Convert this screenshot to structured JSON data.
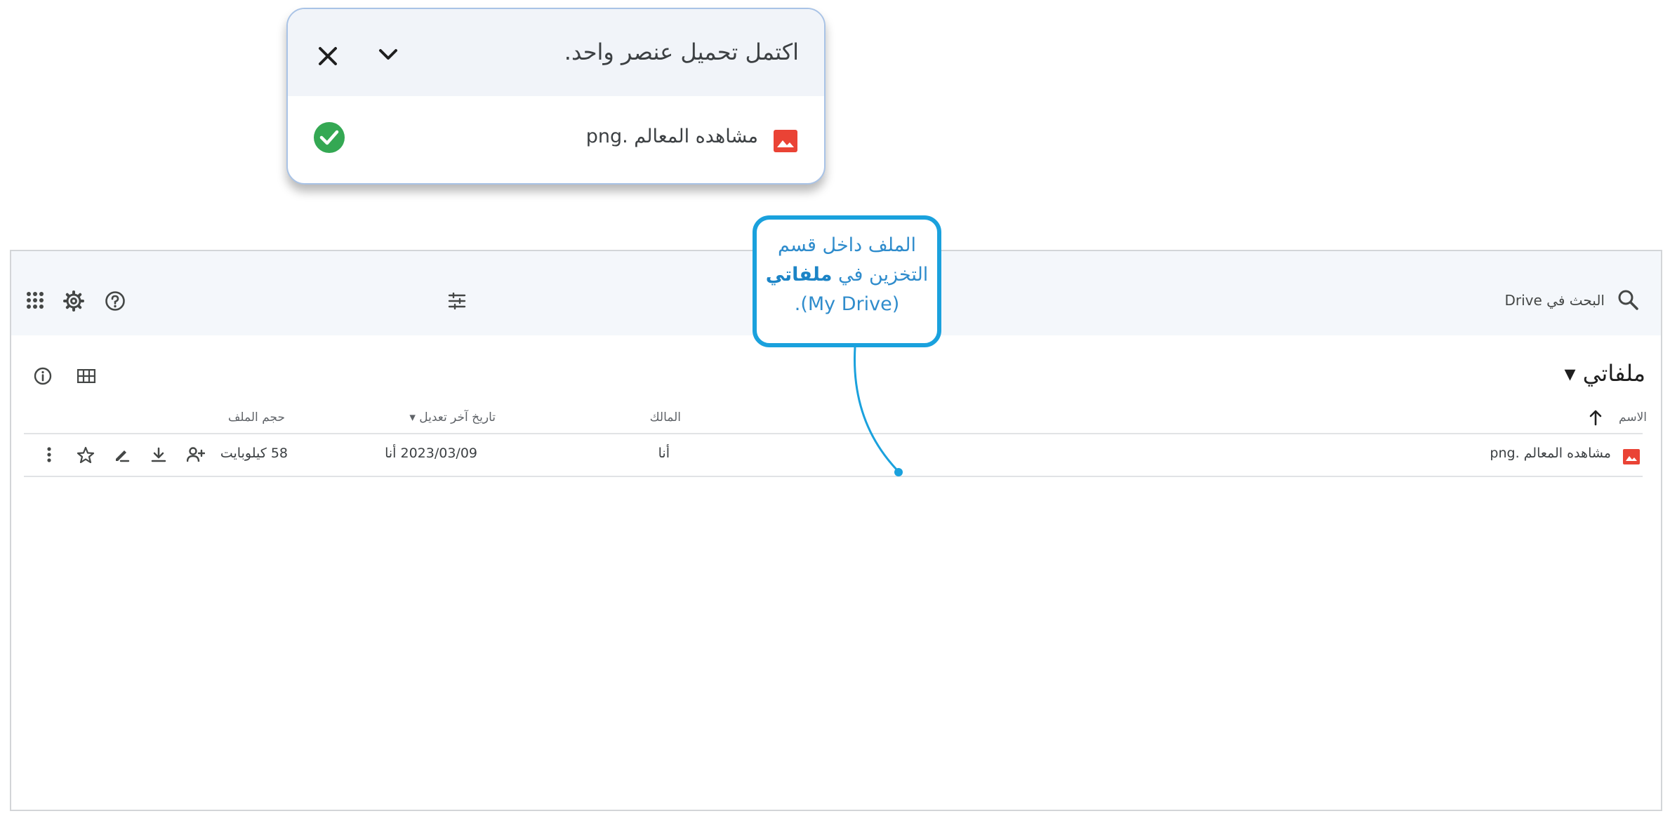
{
  "upload_toast": {
    "title": "اكتمل تحميل عنصر واحد.",
    "file_name": "مشاهده المعالم .png",
    "icons": {
      "collapse": "chevron-down-icon",
      "close": "close-icon",
      "file": "image-file-icon",
      "status": "check-circle-icon"
    },
    "status_color": "#34a853"
  },
  "drive": {
    "search_text": "البحث في Drive",
    "folder_title": "ملفاتي ▾",
    "columns": {
      "name": "الاسم",
      "owner": "المالك",
      "modified": "تاريخ آخر تعديل ▾",
      "size": "حجم الملف"
    },
    "rows": [
      {
        "name": "مشاهده المعالم .png",
        "owner": "أنا",
        "modified": "2023/03/09 أنا",
        "size": "58 كيلوبايت"
      }
    ],
    "toolbar_icons": [
      "apps-grid-icon",
      "gear-icon",
      "help-icon",
      "filter-icon",
      "search-icon",
      "info-icon",
      "grid-view-icon"
    ],
    "row_action_icons": [
      "share-icon",
      "download-icon",
      "rename-icon",
      "star-icon",
      "more-vert-icon"
    ],
    "file_icon_color": "#ea4335"
  },
  "callout": {
    "line1": "الملف داخل قسم",
    "line2_prefix": "التخزين في ",
    "line2_bold": "ملفاتي",
    "line3": "(My Drive).",
    "border_color": "#1aa1dd"
  }
}
